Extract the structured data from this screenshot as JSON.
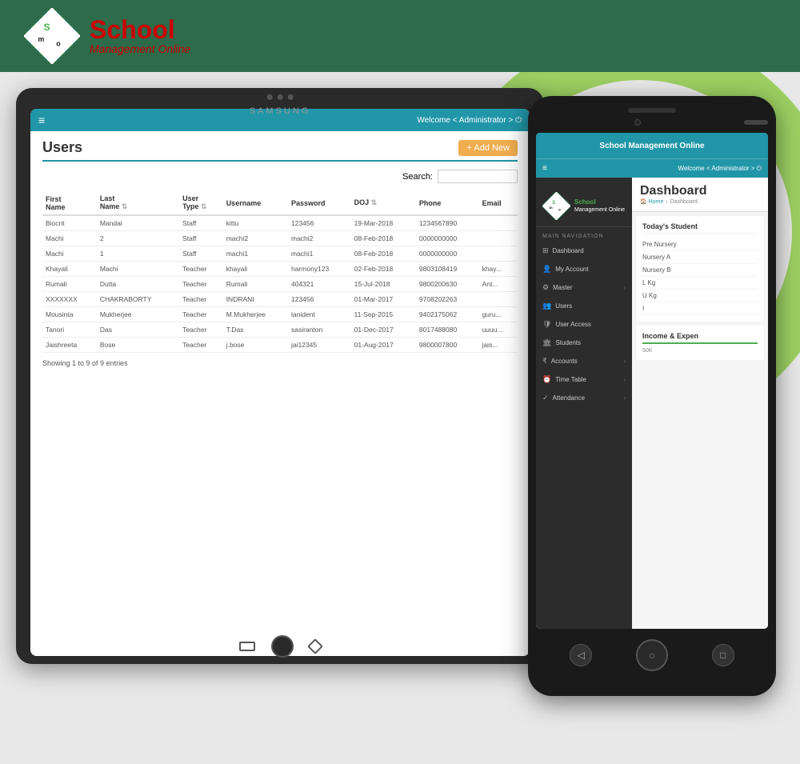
{
  "brand": {
    "name_top": "School",
    "name_sub": "Management Online",
    "logo_letters": [
      "S",
      "M",
      "O"
    ]
  },
  "header": {
    "welcome_text": "Welcome",
    "admin_text": "Administrator",
    "hamburger": "≡"
  },
  "tablet": {
    "brand": "SAMSUNG",
    "screen": {
      "title": "Users",
      "add_button": "+ Add New",
      "search_label": "Search:",
      "table": {
        "headers": [
          "First\nName",
          "Last\nName",
          "User\nType",
          "Username",
          "Password",
          "DOJ",
          "Phone",
          "Email"
        ],
        "rows": [
          [
            "Biocrit",
            "Mandal",
            "Staff",
            "kittu",
            "123456",
            "19-Mar-2018",
            "1234567890",
            ""
          ],
          [
            "Machi",
            "2",
            "Staff",
            "machi2",
            "machi2",
            "08-Feb-2018",
            "0000000000",
            ""
          ],
          [
            "Machi",
            "1",
            "Staff",
            "machi1",
            "machi1",
            "08-Feb-2018",
            "0000000000",
            ""
          ],
          [
            "Khayali",
            "Machi",
            "Teacher",
            "khayali",
            "harmony123",
            "02-Feb-2018",
            "9803108419",
            "khay..."
          ],
          [
            "Rumali",
            "Dutta",
            "Teacher",
            "Rumali",
            "404321",
            "15-Jul-2018",
            "9800200630",
            "Ant..."
          ],
          [
            "XXXXXXX",
            "CHAKRABORTY",
            "Teacher",
            "INDRANI",
            "123456",
            "01-Mar-2017",
            "9708202263",
            ""
          ],
          [
            "Mousinta",
            "Mukherjee",
            "Teacher",
            "M.Mukherjee",
            "lanident",
            "11-Sep-2015",
            "9402175062",
            "guru..."
          ],
          [
            "Tanori",
            "Das",
            "Teacher",
            "T.Das",
            "sasiranton",
            "01-Dec-2017",
            "8017488080",
            "uuuu..."
          ],
          [
            "Jaishreeta",
            "Bose",
            "Teacher",
            "j.bose",
            "jai12345",
            "01-Aug-2017",
            "9800007800",
            "jais..."
          ]
        ]
      },
      "footer": "Showing 1 to 9 of 9 entries"
    }
  },
  "phone": {
    "top_title": "School Management Online",
    "welcome": "Welcome",
    "admin": "Administrator",
    "sidebar": {
      "brand_name": "School",
      "brand_sub": "Management Online",
      "nav_label": "MAIN NAVIGATION",
      "items": [
        {
          "label": "Dashboard",
          "icon": "⊞",
          "arrow": false
        },
        {
          "label": "My Account",
          "icon": "👤",
          "arrow": false
        },
        {
          "label": "Master",
          "icon": "⚙",
          "arrow": true
        },
        {
          "label": "Users",
          "icon": "👥",
          "arrow": false
        },
        {
          "label": "User Access",
          "icon": "🛡",
          "arrow": false
        },
        {
          "label": "Students",
          "icon": "🏛",
          "arrow": false
        },
        {
          "label": "Accounts",
          "icon": "₹",
          "arrow": true
        },
        {
          "label": "Time Table",
          "icon": "⏰",
          "arrow": true
        },
        {
          "label": "Attendance",
          "icon": "✓",
          "arrow": true
        }
      ]
    },
    "dashboard": {
      "title": "Dashboard",
      "breadcrumb_home": "Home",
      "breadcrumb_current": "Dashboard",
      "students_title": "Today's Student",
      "student_rows": [
        {
          "label": "Pre Nursery",
          "value": ""
        },
        {
          "label": "Nursery A",
          "value": ""
        },
        {
          "label": "Nursery B",
          "value": ""
        },
        {
          "label": "L Kg",
          "value": ""
        },
        {
          "label": "U Kg",
          "value": ""
        },
        {
          "label": "I",
          "value": ""
        }
      ],
      "income_title": "Income & Expen",
      "income_value": "50K"
    },
    "bottom_buttons": [
      "◁",
      "○",
      "□"
    ]
  },
  "colors": {
    "teal": "#2196a8",
    "green_brand": "#2d6b4a",
    "green_arc": "#7dc42a",
    "red_brand": "#cc0000",
    "orange_btn": "#f0ad4e",
    "dark_sidebar": "#2c2c2c"
  }
}
